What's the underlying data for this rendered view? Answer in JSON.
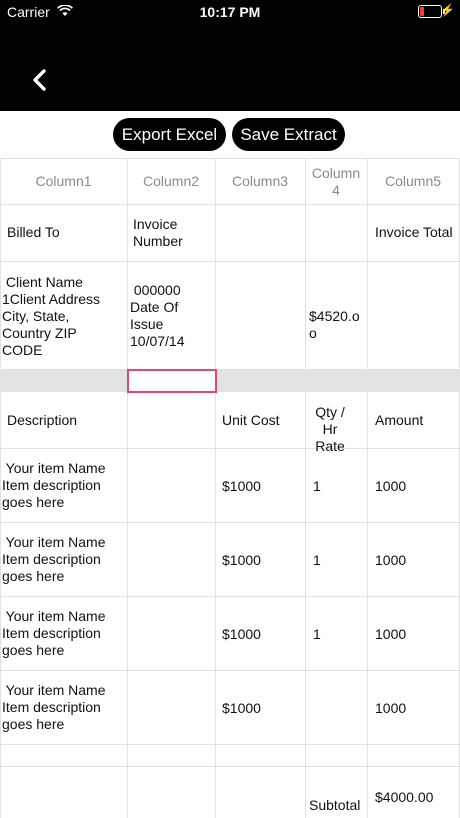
{
  "status": {
    "carrier": "Carrier",
    "time": "10:17 PM"
  },
  "toolbar": {
    "export_label": "Export Excel",
    "save_label": "Save Extract"
  },
  "columns": [
    "Column1",
    "Column2",
    "Column3",
    "Column\n4",
    "Column5"
  ],
  "header_row": {
    "billed_to": "Billed To",
    "invoice_number": "Invoice\nNumber",
    "invoice_total": "Invoice Total"
  },
  "client_row": {
    "client": " Client Name\n1Client Address\nCity, State,\nCountry ZIP\nCODE",
    "invoice": " 000000\nDate Of\nIssue\n10/07/14",
    "total": "$4520.o\no"
  },
  "items_header": {
    "description": "Description",
    "unit_cost": "Unit Cost",
    "qty": "Qty /\nHr Rate",
    "amount": "Amount"
  },
  "items": [
    {
      "desc": " Your item Name\nItem description\ngoes here",
      "unit": "$1000",
      "qty": "1",
      "amount": "1000"
    },
    {
      "desc": " Your item Name\nItem description\ngoes here",
      "unit": "$1000",
      "qty": "1",
      "amount": "1000"
    },
    {
      "desc": " Your item Name\nItem description\ngoes here",
      "unit": "$1000",
      "qty": "1",
      "amount": "1000"
    },
    {
      "desc": " Your item Name\nItem description\ngoes here",
      "unit": "$1000",
      "qty": "",
      "amount": "1000"
    }
  ],
  "subtotal": {
    "label": "Subtotal",
    "value": "$4000.00"
  }
}
